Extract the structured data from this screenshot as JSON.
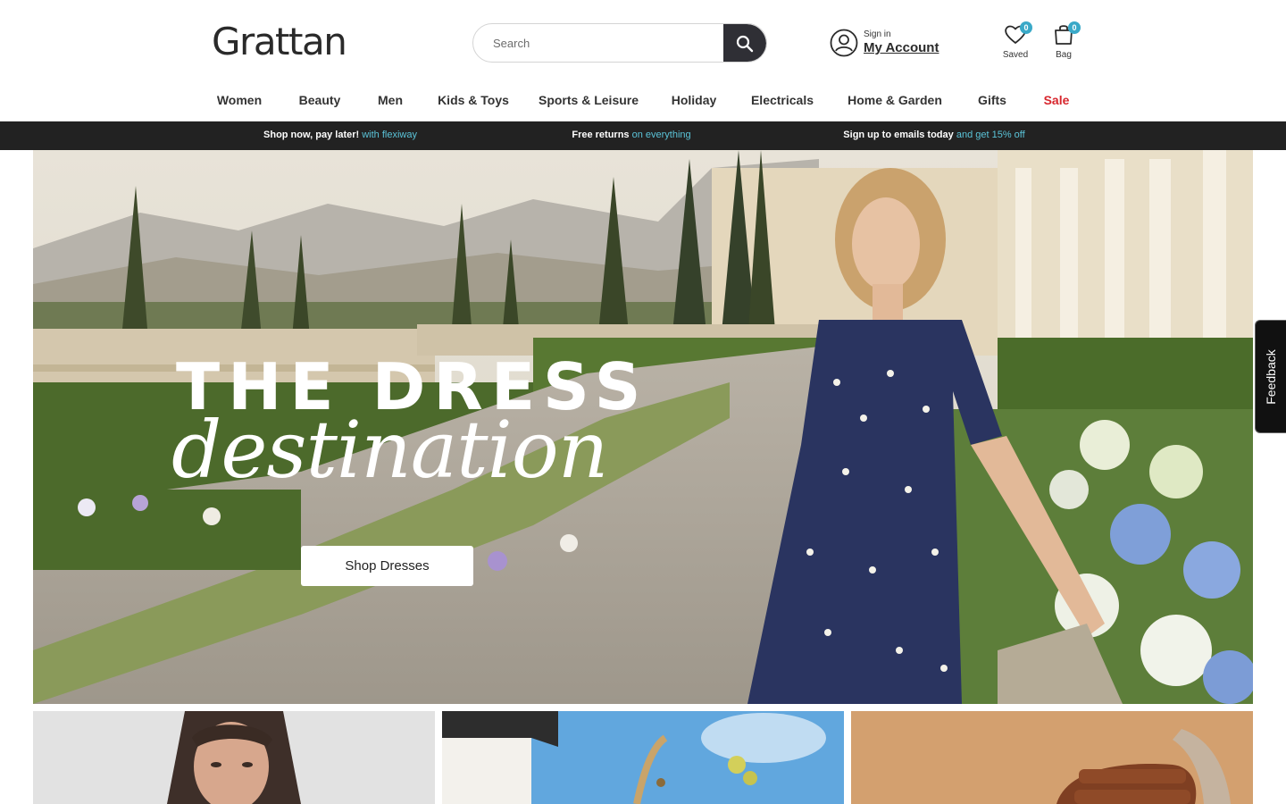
{
  "brand": {
    "name": "Grattan"
  },
  "search": {
    "placeholder": "Search"
  },
  "account": {
    "small_label": "Sign in",
    "main_label": "My Account"
  },
  "saved": {
    "label": "Saved",
    "count": "0"
  },
  "bag": {
    "label": "Bag",
    "count": "0"
  },
  "nav": {
    "items": [
      {
        "label": "Women"
      },
      {
        "label": "Beauty"
      },
      {
        "label": "Men"
      },
      {
        "label": "Kids & Toys"
      },
      {
        "label": "Sports & Leisure"
      },
      {
        "label": "Holiday"
      },
      {
        "label": "Electricals"
      },
      {
        "label": "Home & Garden"
      },
      {
        "label": "Gifts"
      },
      {
        "label": "Sale"
      }
    ]
  },
  "promo": {
    "items": [
      {
        "strong": "Shop now, pay later!",
        "accent": "with flexiway"
      },
      {
        "strong": "Free returns",
        "accent": "on everything"
      },
      {
        "strong": "Sign up to emails today",
        "accent": "and get 15% off"
      }
    ]
  },
  "hero": {
    "title": "THE DRESS",
    "script": "destination",
    "cta": "Shop Dresses"
  },
  "feedback": {
    "label": "Feedback"
  },
  "colors": {
    "dark": "#2f2f35",
    "promo_bg": "#222222",
    "accent": "#5bc4d9",
    "badge": "#3aa9c8",
    "sale": "#d7262d"
  }
}
